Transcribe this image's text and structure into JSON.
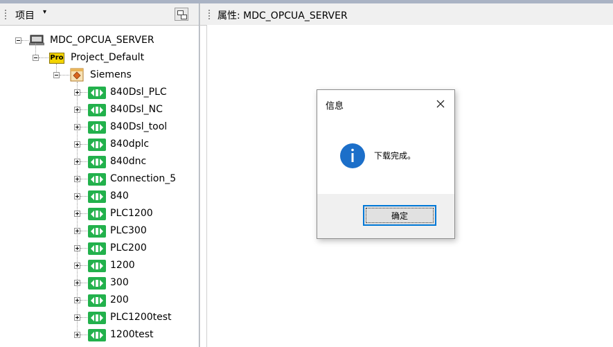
{
  "left_panel": {
    "title": "项目",
    "caret": "▾",
    "tree": {
      "root": "MDC_OPCUA_SERVER",
      "project": "Project_Default",
      "project_icon_text": "Pro",
      "driver": "Siemens",
      "connections": [
        "840Dsl_PLC",
        "840Dsl_NC",
        "840Dsl_tool",
        "840dplc",
        "840dnc",
        "Connection_5",
        "840",
        "PLC1200",
        "PLC300",
        "PLC200",
        "1200",
        "300",
        "200",
        "PLC1200test",
        "1200test"
      ]
    }
  },
  "right_panel": {
    "title": "属性: MDC_OPCUA_SERVER"
  },
  "dialog": {
    "title": "信息",
    "message": "下载完成。",
    "ok_label": "确定",
    "icon": "info-icon"
  },
  "colors": {
    "connection_green": "#22b14c",
    "info_blue": "#1c6fc9",
    "focus_blue": "#0078d7"
  }
}
